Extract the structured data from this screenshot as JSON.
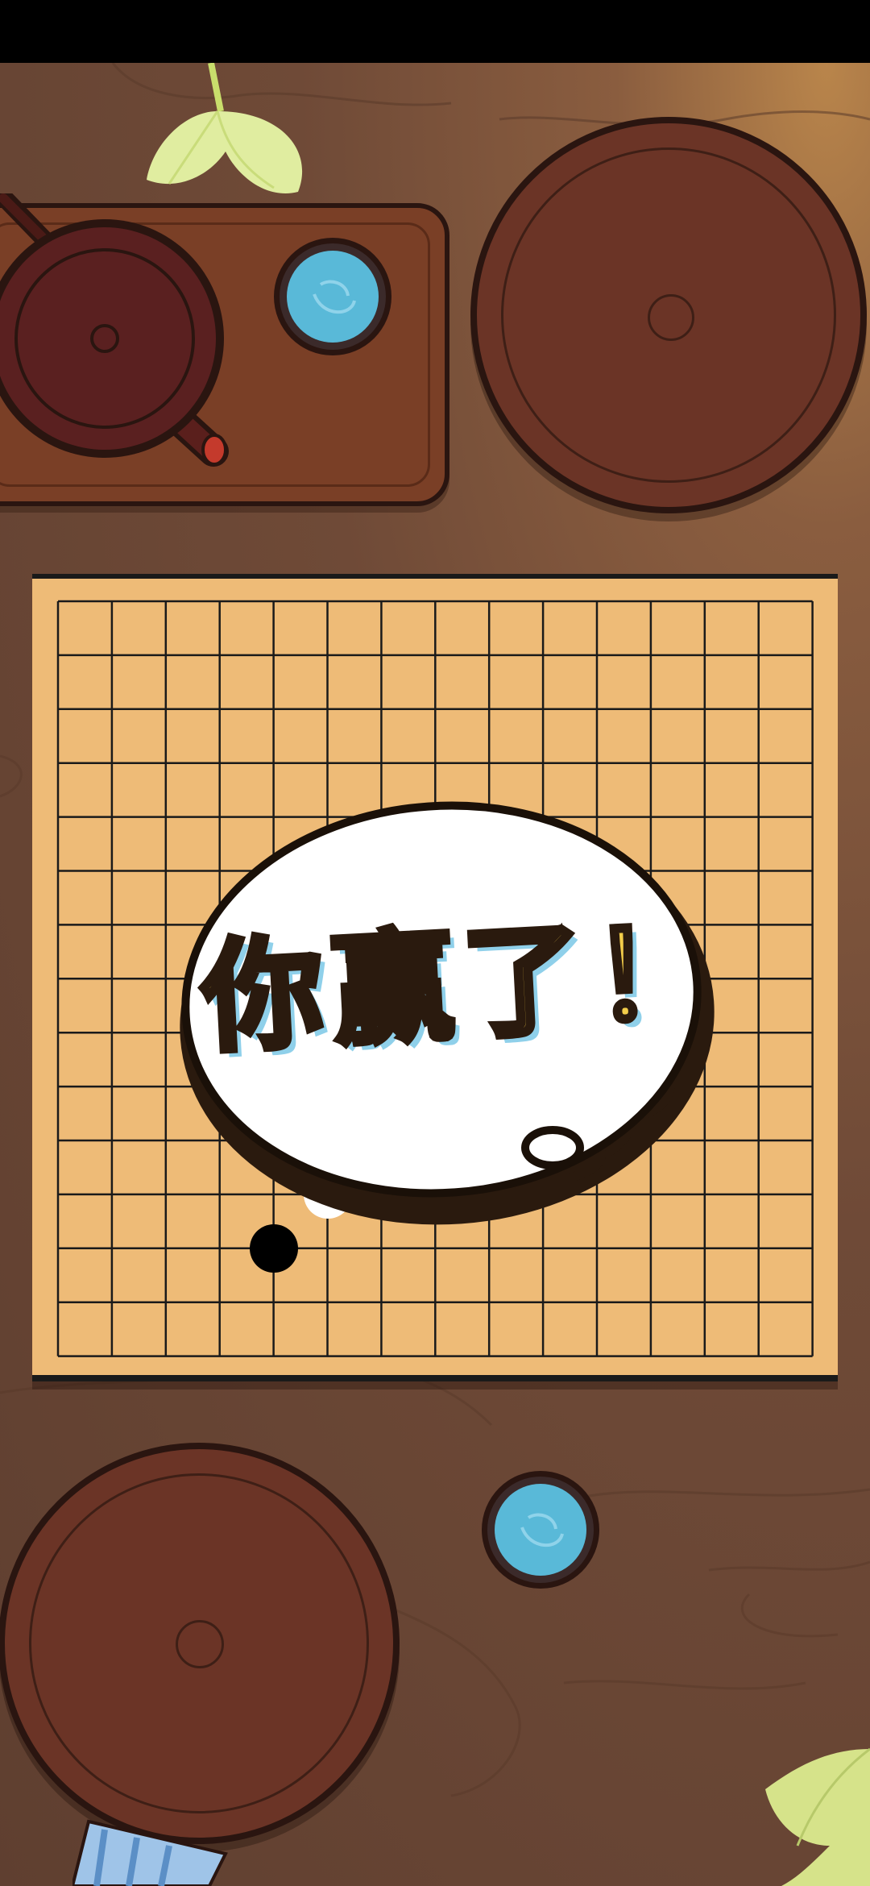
{
  "game": {
    "type": "gomoku",
    "board_size": 15,
    "result_message": "你赢了！",
    "stones": [
      {
        "color": "white",
        "col": 4,
        "row": 10
      },
      {
        "color": "white",
        "col": 6,
        "row": 10
      },
      {
        "color": "white",
        "col": 5,
        "row": 11
      },
      {
        "color": "black",
        "col": 4,
        "row": 12
      }
    ]
  },
  "colors": {
    "board": "#eebb77",
    "grid_line": "#1a1a1a",
    "text_fill": "#f3cd4a",
    "text_shadow": "#8fd0ea",
    "table": "#6f4a37",
    "tea": "#59b9d8"
  },
  "decorations": [
    "ginkgo-leaf-icon",
    "teapot-icon",
    "tea-cup-icon",
    "stone-bowl-icon",
    "water-bottle-icon"
  ]
}
